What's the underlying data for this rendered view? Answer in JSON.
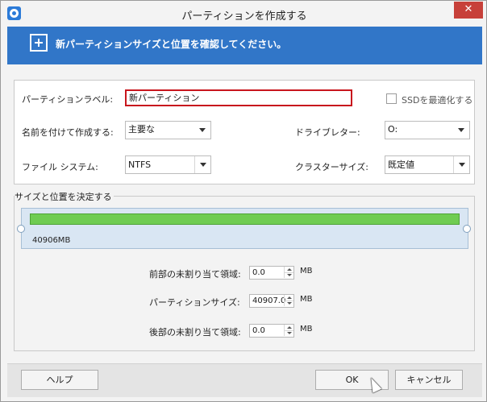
{
  "window": {
    "title": "パーティションを作成する",
    "close_glyph": "✕"
  },
  "banner": {
    "text": "新パーティションサイズと位置を確認してください。"
  },
  "form": {
    "partition_label_label": "パーティションラベル:",
    "partition_label_value": "新パーティション",
    "ssd_optimize_label": "SSDを最適化する",
    "ssd_optimize_checked": false,
    "create_as_label": "名前を付けて作成する:",
    "create_as_value": "主要な",
    "drive_letter_label": "ドライブレター:",
    "drive_letter_value": "O:",
    "file_system_label": "ファイル システム:",
    "file_system_value": "NTFS",
    "cluster_size_label": "クラスターサイズ:",
    "cluster_size_value": "既定値"
  },
  "size_location": {
    "group_title": "サイズと位置を決定する",
    "disk_size_text": "40906MB",
    "disk_fill_fraction": 1.0,
    "unallocated_before_label": "前部の未割り当て領域:",
    "unallocated_before_value": "0.0",
    "partition_size_label": "パーティションサイズ:",
    "partition_size_value": "40907.0",
    "unallocated_after_label": "後部の未割り当て領域:",
    "unallocated_after_value": "0.0",
    "unit": "MB"
  },
  "footer": {
    "help_label": "ヘルプ",
    "ok_label": "OK",
    "cancel_label": "キャンセル"
  },
  "colors": {
    "banner": "#3176c8",
    "highlight_border": "#c8161d",
    "disk_bar": "#6fcc52",
    "close_button": "#c7403a"
  }
}
